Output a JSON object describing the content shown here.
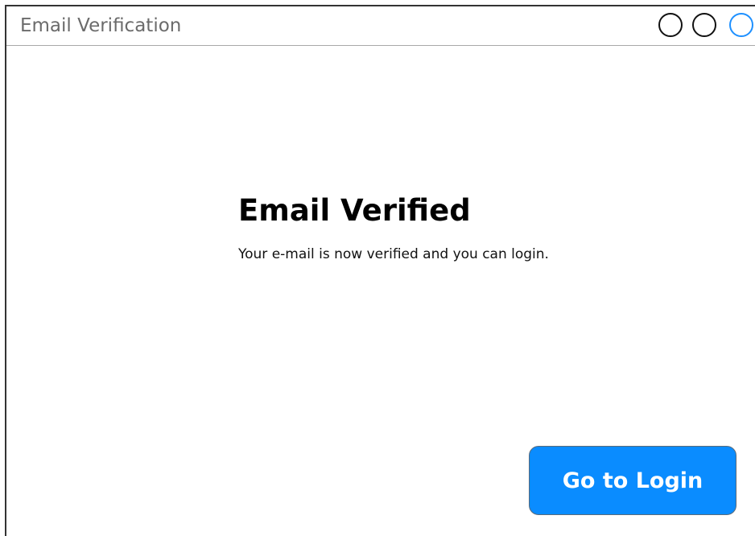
{
  "window": {
    "title": "Email Verification"
  },
  "content": {
    "heading": "Email Verified",
    "message": "Your e-mail is now verified and you can login."
  },
  "actions": {
    "login_label": "Go to Login"
  },
  "colors": {
    "accent": "#0a8cff",
    "close_control": "#1e90ff",
    "title_text": "#6b6b6b"
  },
  "icons": {
    "minimize": "circle-outline-icon",
    "maximize": "circle-outline-icon",
    "close": "circle-outline-blue-icon"
  }
}
